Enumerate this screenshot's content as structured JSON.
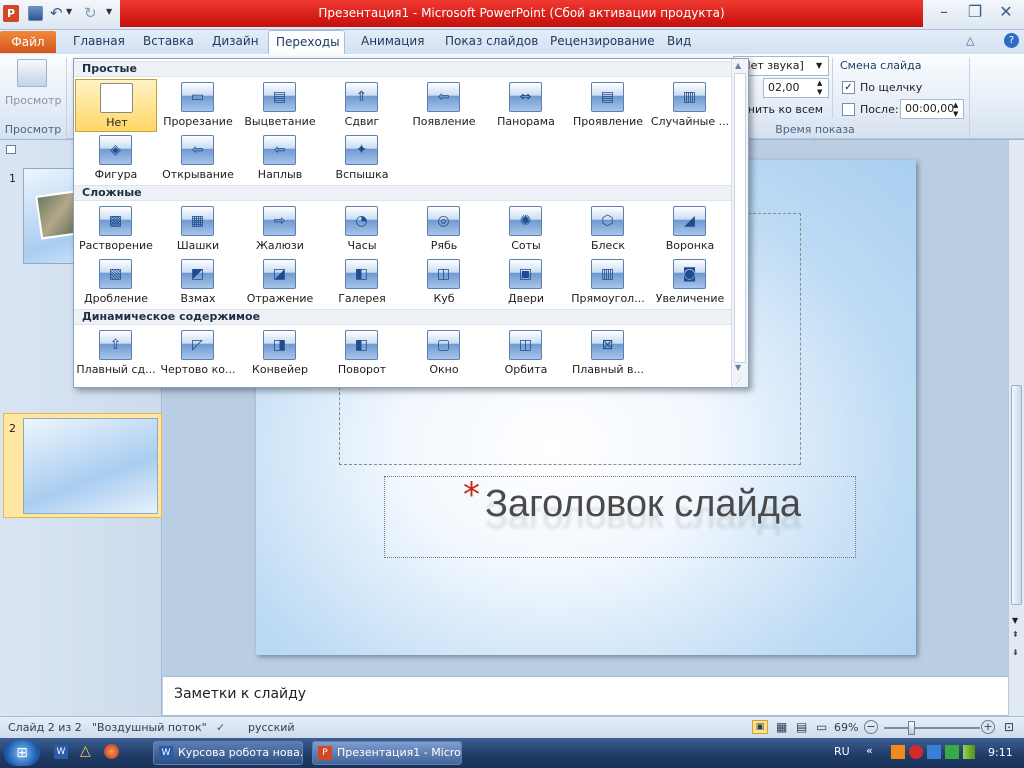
{
  "window": {
    "title": "Презентация1 - Microsoft PowerPoint (Сбой активации продукта)"
  },
  "tabs": [
    {
      "label": "Файл"
    },
    {
      "label": "Главная"
    },
    {
      "label": "Вставка"
    },
    {
      "label": "Дизайн"
    },
    {
      "label": "Переходы"
    },
    {
      "label": "Анимация"
    },
    {
      "label": "Показ слайдов"
    },
    {
      "label": "Рецензирование"
    },
    {
      "label": "Вид"
    }
  ],
  "ribbon": {
    "preview_button": "Просмотр",
    "preview_group": "Просмотр",
    "sound_value": "[Нет звука]",
    "duration_value": "02,00",
    "apply_all": "Применить ко всем",
    "timing_group": "Время показа слайдов",
    "advance_header": "Смена слайда",
    "on_click_label": "По щелчку",
    "on_click_checked": true,
    "after_label": "После:",
    "after_checked": false,
    "after_value": "00:00,00"
  },
  "gallery": {
    "sections": [
      {
        "title": "Простые",
        "items": [
          "Нет",
          "Прорезание",
          "Выцветание",
          "Сдвиг",
          "Появление",
          "Панорама",
          "Проявление",
          "Случайные ...",
          "Фигура",
          "Открывание",
          "Наплыв",
          "Вспышка"
        ]
      },
      {
        "title": "Сложные",
        "items": [
          "Растворение",
          "Шашки",
          "Жалюзи",
          "Часы",
          "Рябь",
          "Соты",
          "Блеск",
          "Воронка",
          "Дробление",
          "Взмах",
          "Отражение",
          "Галерея",
          "Куб",
          "Двери",
          "Прямоугол...",
          "Увеличение"
        ]
      },
      {
        "title": "Динамическое содержимое",
        "items": [
          "Плавный сд...",
          "Чертово ко...",
          "Конвейер",
          "Поворот",
          "Окно",
          "Орбита",
          "Плавный в..."
        ]
      }
    ],
    "selected": "Нет"
  },
  "slides_pane": {
    "numbers": [
      "1",
      "2"
    ],
    "selected": "2"
  },
  "slide": {
    "title_text": "Заголовок слайда",
    "marker": "*"
  },
  "notes": {
    "placeholder": "Заметки к слайду"
  },
  "status": {
    "slide_info": "Слайд 2 из 2",
    "theme": "\"Воздушный поток\"",
    "language": "русский",
    "zoom": "69%"
  },
  "taskbar": {
    "items": [
      "Курсова робота нова...",
      "Презентация1 - Micro..."
    ],
    "lang": "RU",
    "time": "9:11"
  },
  "colors": {
    "title_red": "#d81e17",
    "file_tab": "#e06a25",
    "selection": "#ffd766"
  }
}
